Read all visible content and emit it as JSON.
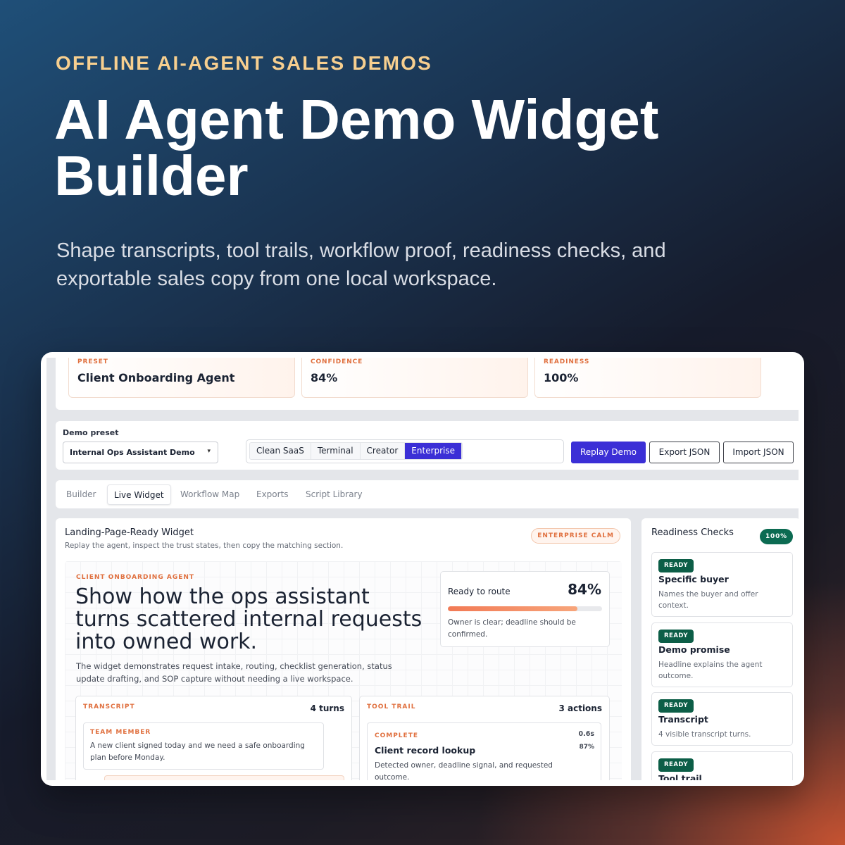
{
  "hero": {
    "eyebrow": "OFFLINE AI-AGENT SALES DEMOS",
    "title": "AI Agent Demo Widget Builder",
    "subtitle": "Shape transcripts, tool trails, workflow proof, readiness checks, and exportable sales copy from one local workspace."
  },
  "stats": [
    {
      "label": "PRESET",
      "value": "Client Onboarding Agent"
    },
    {
      "label": "CONFIDENCE",
      "value": "84%"
    },
    {
      "label": "READINESS",
      "value": "100%"
    }
  ],
  "controls": {
    "preset_label": "Demo preset",
    "preset_value": "Internal Ops Assistant Demo",
    "themes": [
      "Clean SaaS",
      "Terminal",
      "Creator",
      "Enterprise"
    ],
    "active_theme": "Enterprise",
    "replay_label": "Replay Demo",
    "export_label": "Export JSON",
    "import_label": "Import JSON"
  },
  "tabs": [
    "Builder",
    "Live Widget",
    "Workflow Map",
    "Exports",
    "Script Library"
  ],
  "active_tab": "Live Widget",
  "widget": {
    "title": "Landing-Page-Ready Widget",
    "description": "Replay the agent, inspect the trust states, then copy the matching section.",
    "theme_badge": "ENTERPRISE CALM",
    "agent_eyebrow": "CLIENT ONBOARDING AGENT",
    "headline": "Show how the ops assistant turns scattered internal requests into owned work.",
    "body": "The widget demonstrates request intake, routing, checklist generation, status update drafting, and SOP capture without needing a live workspace.",
    "route": {
      "label": "Ready to route",
      "value": "84%",
      "progress": 0.84,
      "note": "Owner is clear; deadline should be confirmed."
    },
    "transcript": {
      "title": "TRANSCRIPT",
      "count": "4 turns",
      "messages": [
        {
          "role": "TEAM MEMBER",
          "text": "A new client signed today and we need a safe onboarding plan before Monday."
        }
      ]
    },
    "tool_trail": {
      "title": "TOOL TRAIL",
      "count": "3 actions",
      "steps": [
        {
          "status": "COMPLETE",
          "time": "0.6s",
          "confidence": "87%",
          "name": "Client record lookup",
          "description": "Detected owner, deadline signal, and requested outcome."
        }
      ]
    }
  },
  "readiness": {
    "title": "Readiness Checks",
    "badge": "100%",
    "checks": [
      {
        "status": "READY",
        "name": "Specific buyer",
        "description": "Names the buyer and offer context."
      },
      {
        "status": "READY",
        "name": "Demo promise",
        "description": "Headline explains the agent outcome."
      },
      {
        "status": "READY",
        "name": "Transcript",
        "description": "4 visible transcript turns."
      },
      {
        "status": "READY",
        "name": "Tool trail",
        "description": ""
      }
    ]
  },
  "colors": {
    "accent_orange": "#e0703f",
    "primary_purple": "#3b2fd6",
    "ready_green": "#0c5e47",
    "eyebrow_gold": "#f7cf8f"
  }
}
